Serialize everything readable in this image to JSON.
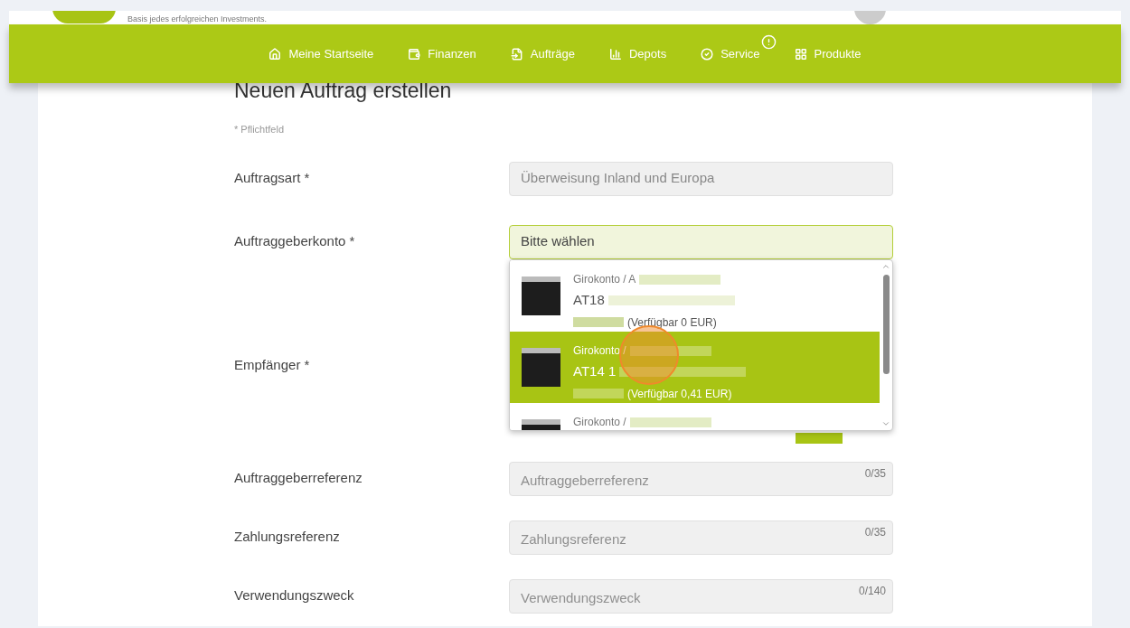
{
  "header": {
    "tagline": "Basis jedes erfolgreichen Investments."
  },
  "nav": [
    {
      "label": "Meine Startseite",
      "alert": false
    },
    {
      "label": "Finanzen",
      "alert": false
    },
    {
      "label": "Aufträge",
      "alert": false
    },
    {
      "label": "Depots",
      "alert": false
    },
    {
      "label": "Service",
      "alert": true
    },
    {
      "label": "Produkte",
      "alert": false
    }
  ],
  "form": {
    "title": "Neuen Auftrag erstellen",
    "required_note": "* Pflichtfeld",
    "fields": [
      {
        "kind": "select",
        "label": "Auftragsart *",
        "value": "Überweisung Inland und Europa",
        "focused": false
      },
      {
        "kind": "select",
        "label": "Auftraggeberkonto *",
        "value": "Bitte wählen",
        "focused": true
      },
      {
        "kind": "recipient",
        "label": "Empfänger *"
      },
      {
        "kind": "text",
        "label": "Auftraggeberreferenz",
        "placeholder": "Auftraggeberreferenz",
        "counter": "0/35"
      },
      {
        "kind": "text",
        "label": "Zahlungsreferenz",
        "placeholder": "Zahlungsreferenz",
        "counter": "0/35"
      },
      {
        "kind": "text",
        "label": "Verwendungszweck",
        "placeholder": "Verwendungszweck",
        "counter": "0/140"
      }
    ]
  },
  "dropdown": {
    "items": [
      {
        "account_type": "Girokonto / A",
        "iban": "AT18",
        "available": "(Verfügbar 0 EUR)",
        "selected": false
      },
      {
        "account_type": "Girokonto /",
        "iban": "AT14 1",
        "available": "(Verfügbar 0,41 EUR)",
        "selected": true
      },
      {
        "account_type": "Girokonto /",
        "selected": false
      }
    ]
  }
}
